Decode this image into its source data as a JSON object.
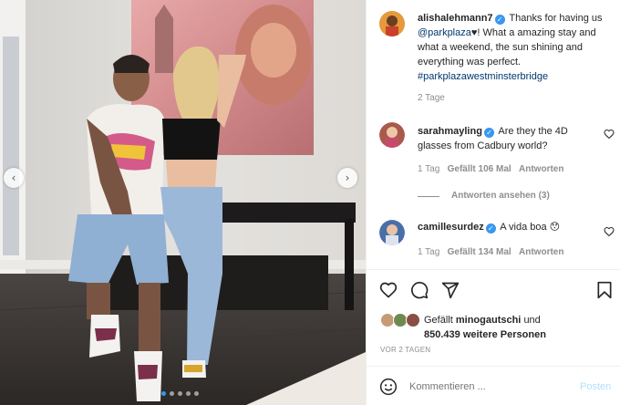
{
  "post": {
    "author": "alishalehmann7",
    "caption_text": "Thanks for having us",
    "caption_mention": "@parkplaza",
    "caption_heart": "♥",
    "caption_rest_1": "! What a amazing stay and",
    "caption_line_3": "what a weekend, the sun shining and",
    "caption_line_4": "everything was perfect.",
    "caption_hashtag": "#parkplazawestminsterbridge",
    "caption_age": "2 Tage"
  },
  "comments": [
    {
      "user": "sarahmayling",
      "text_1": "Are they the 4D",
      "text_2": "glasses from Cadbury world?",
      "age": "1 Tag",
      "likes": "Gefällt 106 Mal",
      "reply": "Antworten"
    },
    {
      "user": "camillesurdez",
      "text_1": "A vida boa",
      "emoji": "😯",
      "age": "1 Tag",
      "likes": "Gefällt 134 Mal",
      "reply": "Antworten"
    }
  ],
  "replies_toggle": "Antworten ansehen (3)",
  "likes": {
    "prefix": "Gefällt",
    "user": "minogautschi",
    "suffix": "und",
    "count": "850.439 weitere Personen"
  },
  "post_age": "VOR 2 TAGEN",
  "comment_box": {
    "placeholder": "Kommentieren ...",
    "submit": "Posten"
  },
  "carousel": {
    "slides": 5,
    "active_index": 0
  },
  "icons": {
    "like": "heart-icon",
    "comment": "comment-icon",
    "share": "share-icon",
    "save": "bookmark-icon",
    "emoji": "emoji-icon"
  },
  "colors": {
    "link": "#00376b",
    "verified": "#3897f0",
    "muted": "#8e8e8e",
    "post_disabled": "#b2dffc"
  }
}
